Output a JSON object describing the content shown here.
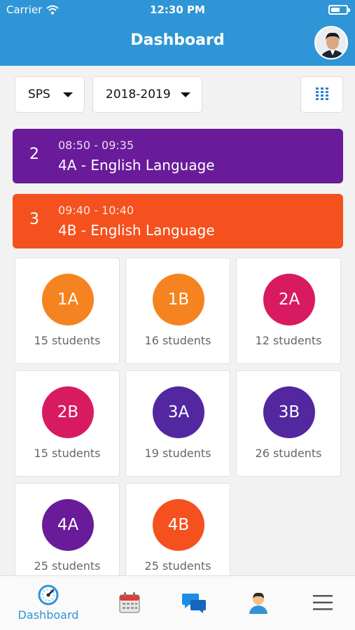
{
  "status": {
    "carrier": "Carrier",
    "time": "12:30 PM",
    "battery_level": 0.6
  },
  "header": {
    "title": "Dashboard"
  },
  "filters": {
    "school": "SPS",
    "year": "2018-2019"
  },
  "lessons": [
    {
      "number": "2",
      "time": "08:50 - 09:35",
      "title": "4A - English Language",
      "color": "#6a1b9a"
    },
    {
      "number": "3",
      "time": "09:40 - 10:40",
      "title": "4B - English Language",
      "color": "#f4511e"
    }
  ],
  "classes": [
    {
      "name": "1A",
      "students": "15 students",
      "color": "#f5831f"
    },
    {
      "name": "1B",
      "students": "16 students",
      "color": "#f5831f"
    },
    {
      "name": "2A",
      "students": "12 students",
      "color": "#d81b60"
    },
    {
      "name": "2B",
      "students": "15 students",
      "color": "#d81b60"
    },
    {
      "name": "3A",
      "students": "19 students",
      "color": "#5227a0"
    },
    {
      "name": "3B",
      "students": "26 students",
      "color": "#5227a0"
    },
    {
      "name": "4A",
      "students": "25 students",
      "color": "#6a1b9a"
    },
    {
      "name": "4B",
      "students": "25 students",
      "color": "#f4511e"
    }
  ],
  "tabbar": {
    "items": [
      {
        "icon": "dashboard-gauge-icon",
        "label": "Dashboard",
        "active": true
      },
      {
        "icon": "calendar-icon"
      },
      {
        "icon": "chat-icon"
      },
      {
        "icon": "profile-icon"
      },
      {
        "icon": "menu-icon"
      }
    ],
    "active_color": "#2f95d6"
  },
  "colors": {
    "header": "#2f95d6",
    "background": "#f2f2f2"
  }
}
